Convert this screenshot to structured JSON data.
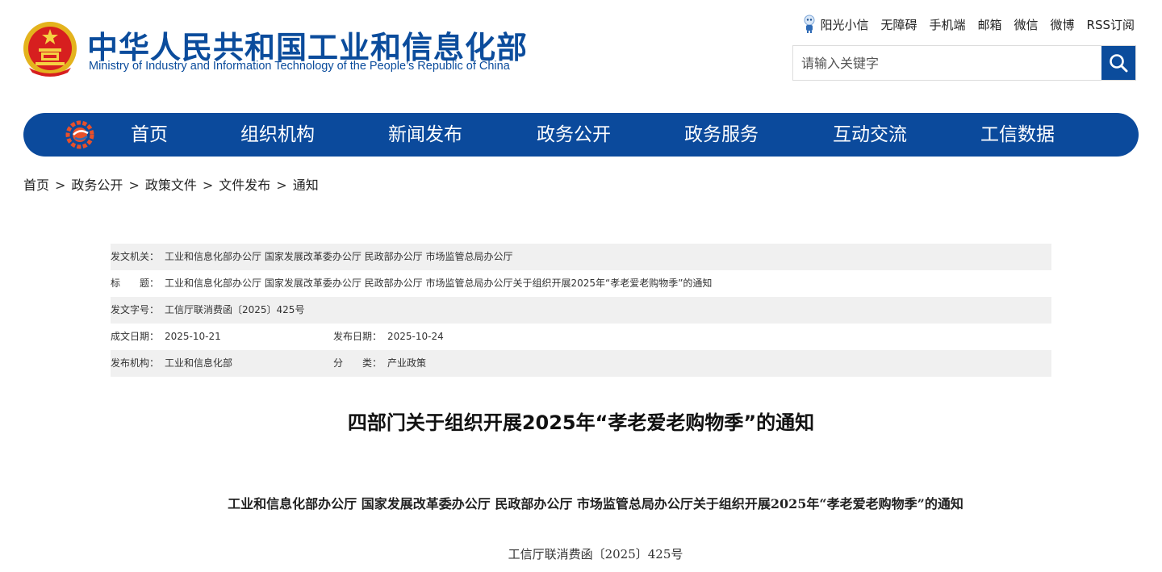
{
  "header": {
    "title": "中华人民共和国工业和信息化部",
    "subtitle": "Ministry of Industry and Information Technology of the People’s Republic of China",
    "top_links": [
      "阳光小信",
      "无障碍",
      "手机端",
      "邮箱",
      "微信",
      "微博",
      "RSS订阅"
    ],
    "search_placeholder": "请输入关键字"
  },
  "nav": {
    "items": [
      "首页",
      "组织机构",
      "新闻发布",
      "政务公开",
      "政务服务",
      "互动交流",
      "工信数据"
    ]
  },
  "breadcrumb": [
    "首页",
    "政务公开",
    "政策文件",
    "文件发布",
    "通知"
  ],
  "breadcrumb_separator": ">",
  "meta": {
    "issuer_label": "发文机关：",
    "issuer": "工业和信息化部办公厅 国家发展改革委办公厅 民政部办公厅 市场监管总局办公厅",
    "title_label": "标　　题：",
    "title": "工业和信息化部办公厅 国家发展改革委办公厅 民政部办公厅 市场监管总局办公厅关于组织开展2025年“孝老爱老购物季”的通知",
    "doc_no_label": "发文字号：",
    "doc_no": "工信厅联消费函〔2025〕425号",
    "created_label": "成文日期：",
    "created": "2025-10-21",
    "published_label": "发布日期：",
    "published": "2025-10-24",
    "org_label": "发布机构：",
    "org": "工业和信息化部",
    "category_label": "分　　类：",
    "category": "产业政策"
  },
  "document": {
    "title": "四部门关于组织开展2025年“孝老爱老购物季”的通知",
    "heading": "工业和信息化部办公厅 国家发展改革委办公厅 民政部办公厅 市场监管总局办公厅关于组织开展2025年“孝老爱老购物季”的通知",
    "number": "工信厅联消费函〔2025〕425号"
  },
  "colors": {
    "brand": "#0b4c9c",
    "meta_row_gray": "#f0f0f0"
  }
}
